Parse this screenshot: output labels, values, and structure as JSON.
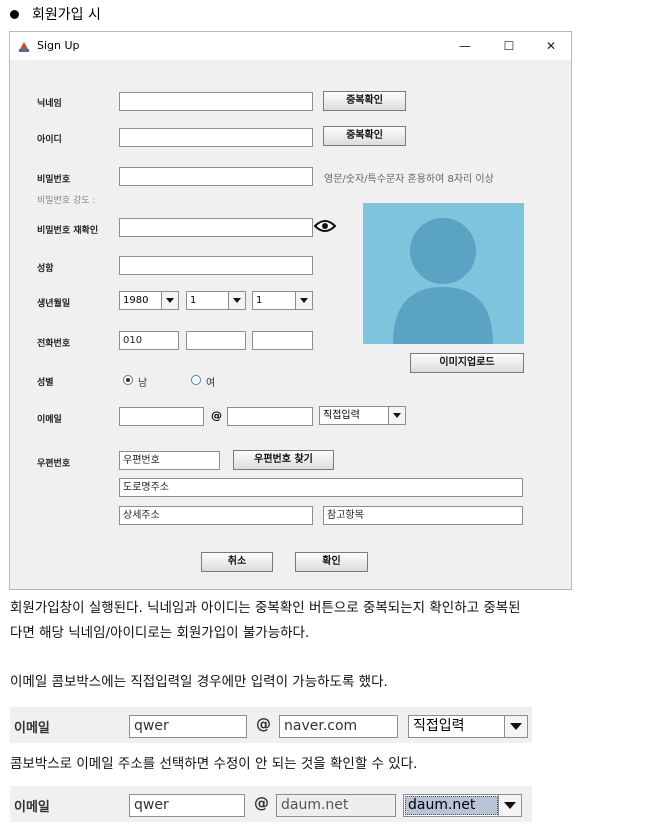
{
  "heading": "회원가입 시",
  "window": {
    "title": "Sign Up",
    "minimize": "—",
    "maximize": "☐",
    "close": "✕"
  },
  "form": {
    "nickname_label": "닉네임",
    "id_label": "아이디",
    "check_dup": "중복확인",
    "password_label": "비밀번호",
    "password_hint": "영문/숫자/특수문자 혼용하여 8자리 이상",
    "strength_label": "비밀번호 강도 :",
    "confirm_label": "비밀번호 재확인",
    "name_label": "성함",
    "birth_label": "생년월일",
    "birth_year": "1980",
    "birth_month": "1",
    "birth_day": "1",
    "phone_label": "전화번호",
    "phone_first": "010",
    "upload_label": "이미지업로드",
    "gender_label": "성별",
    "male": "남",
    "female": "여",
    "email_label": "이메일",
    "at": "@",
    "email_domain_option": "직접입력",
    "zip_label": "우편번호",
    "zip_placeholder": "우편번호",
    "find_zip": "우편번호 찾기",
    "road_placeholder": "도로명주소",
    "detail_placeholder": "상세주소",
    "ref_placeholder": "참고항목",
    "cancel": "취소",
    "ok": "확인"
  },
  "text": {
    "para1_line1": "회원가입창이 실행된다. 닉네임과 아이디는 중복확인 버튼으로 중복되는지 확인하고 중복된",
    "para1_line2": "다면 해당 닉네임/아이디로는 회원가입이 불가능하다.",
    "para2": "이메일 콤보박스에는 직접입력일 경우에만 입력이 가능하도록 했다.",
    "para3": "콤보박스로 이메일 주소를 선택하면 수정이 안 되는 것을 확인할 수 있다."
  },
  "example1": {
    "label": "이메일",
    "local": "qwer",
    "at": "@",
    "domain": "naver.com",
    "combo": "직접입력"
  },
  "example2": {
    "label": "이메일",
    "local": "qwer",
    "at": "@",
    "domain": "daum.net",
    "combo": "daum.net"
  },
  "colors": {
    "avatar_bg": "#7ec4dc",
    "avatar_fg": "#5aa3c2"
  }
}
